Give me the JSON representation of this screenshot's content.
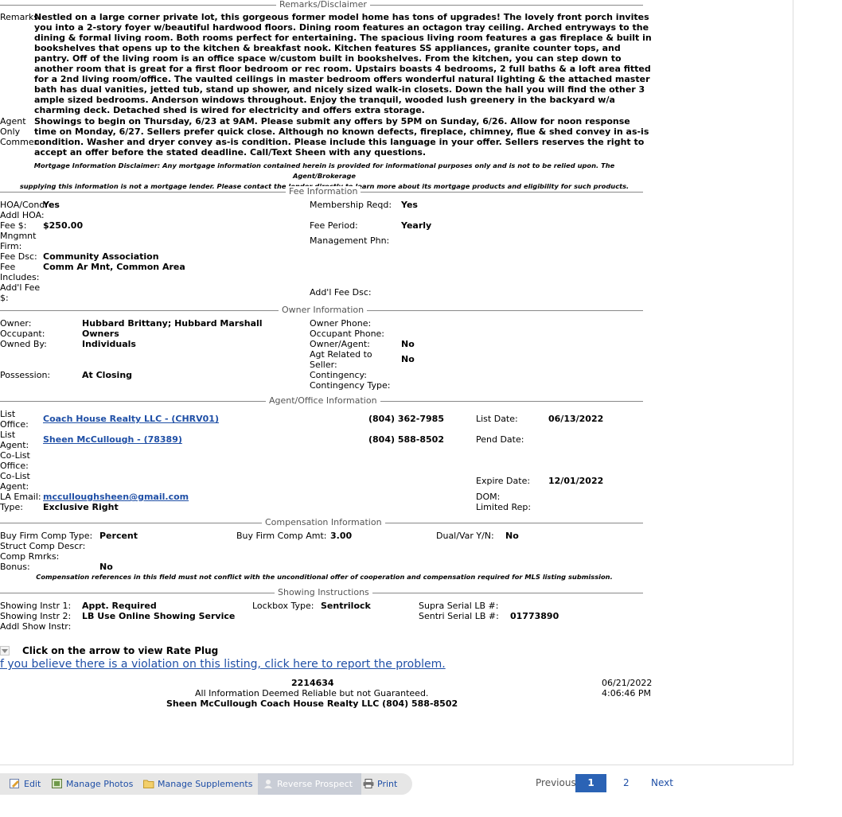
{
  "remarks_section": {
    "title": "Remarks/Disclaimer",
    "remarks_label": "Remarks",
    "remarks_lines": [
      "Nestled on a large corner private lot, this gorgeous former model home has tons of upgrades! The lovely front porch invites",
      "you into a 2-story foyer w/beautiful hardwood floors. Dining room features an octagon tray ceiling. Arched entryways to the",
      "dining & formal living room. Both rooms perfect for entertaining. The spacious living room features a gas fireplace & built in",
      "bookshelves that opens up to the kitchen & breakfast nook. Kitchen features SS appliances, granite counter tops, and",
      "pantry. Off of the living room is an office space w/custom built in bookshelves. From the kitchen, you can step down to",
      "another room that is great for a first floor bedroom or rec room. Upstairs boasts 4 bedrooms, 2 full baths & a loft area fitted",
      "for a 2nd living room/office. The vaulted ceilings in master bedroom offers wonderful natural lighting & the attached master",
      "bath has dual vanities, jetted tub, stand up shower, and nicely sized walk-in closets. Down the hall you will find the other 3",
      "ample sized bedrooms. Anderson windows throughout. Enjoy the tranquil, wooded lush greenery in the backyard w/a",
      "charming deck. Detached shed is wired for electricity and offers extra storage."
    ],
    "agent_label_1": "Agent",
    "agent_label_2": "Only",
    "agent_label_3": "Commen",
    "agent_lines": [
      "Showings to begin on Thursday, 6/23 at 9AM. Please submit any offers by 5PM on Sunday, 6/26. Allow for noon response",
      "time on Monday, 6/27. Sellers prefer quick close. Although no known defects, fireplace, chimney, flue & shed convey in as-is",
      "condition. Washer and dryer convey as-is condition. Please include this language in your offer. Sellers reserves the right to",
      "accept an offer before the stated deadline. Call/Text Sheen with any questions."
    ],
    "mortgage_disclaimer_1": "Mortgage Information Disclaimer: Any mortgage information contained herein is provided for informational purposes only and is not to be relied upon. The Agent/Brokerage",
    "mortgage_disclaimer_2": "supplying this information is not a mortgage lender. Please contact the lender directly to learn more about its mortgage products and eligibility for such products."
  },
  "fee_section": {
    "title": "Fee Information",
    "hoa_label": "HOA/Cond:",
    "hoa_value": "Yes",
    "addl_hoa_label": "Addl HOA:",
    "fee_label": "Fee $:",
    "fee_value": "$250.00",
    "mngmt_label_1": "Mngmnt",
    "mngmt_label_2": "Firm:",
    "fee_dsc_label": "Fee Dsc:",
    "fee_dsc_value": "Community Association",
    "fee_incl_label_1": "Fee",
    "fee_incl_label_2": "Includes:",
    "fee_incl_value": "Comm Ar Mnt, Common Area",
    "addl_fee_label_1": "Add'l Fee",
    "addl_fee_label_2": "$:",
    "membership_label": "Membership Reqd:",
    "membership_value": "Yes",
    "fee_period_label": "Fee Period:",
    "fee_period_value": "Yearly",
    "mgmt_phone_label": "Management Phn:",
    "addl_fee_dsc_label": "Add'l Fee Dsc:"
  },
  "owner_section": {
    "title": "Owner Information",
    "owner_label": "Owner:",
    "owner_value": "Hubbard Brittany; Hubbard Marshall",
    "occupant_label": "Occupant:",
    "occupant_value": "Owners",
    "owned_by_label": "Owned By:",
    "owned_by_value": "Individuals",
    "possession_label": "Possession:",
    "possession_value": "At Closing",
    "owner_phone_label": "Owner Phone:",
    "occupant_phone_label": "Occupant Phone:",
    "owner_agent_label": "Owner/Agent:",
    "owner_agent_value": "No",
    "agt_related_label_1": "Agt Related to",
    "agt_related_label_2": "Seller:",
    "agt_related_value": "No",
    "contingency_label": "Contingency:",
    "contingency_type_label": "Contingency Type:"
  },
  "agent_section": {
    "title": "Agent/Office Information",
    "list_office_label_1": "List",
    "list_office_label_2": "Office:",
    "list_office_value": "Coach House Realty LLC - (CHRV01)",
    "list_office_phone": "(804) 362-7985",
    "list_agent_label_1": "List",
    "list_agent_label_2": "Agent:",
    "list_agent_value": "Sheen McCullough - (78389)",
    "list_agent_phone": "(804) 588-8502",
    "colist_office_label_1": "Co-List",
    "colist_office_label_2": "Office:",
    "colist_agent_label_1": "Co-List",
    "colist_agent_label_2": "Agent:",
    "la_email_label": "LA Email:",
    "la_email_value": "mcculloughsheen@gmail.com",
    "type_label": "Type:",
    "type_value": "Exclusive Right",
    "list_date_label": "List Date:",
    "list_date_value": "06/13/2022",
    "pend_date_label": "Pend Date:",
    "expire_date_label": "Expire Date:",
    "expire_date_value": "12/01/2022",
    "dom_label": "DOM:",
    "limited_rep_label": "Limited Rep:"
  },
  "compensation_section": {
    "title": "Compensation Information",
    "buy_firm_type_label": "Buy Firm Comp Type:",
    "buy_firm_type_value": "Percent",
    "buy_firm_amt_label": "Buy Firm Comp Amt:",
    "buy_firm_amt_value": "3.00",
    "dual_var_label": "Dual/Var Y/N:",
    "dual_var_value": "No",
    "struct_label": "Struct Comp Descr:",
    "comp_rmrks_label": "Comp Rmrks:",
    "bonus_label": "Bonus:",
    "bonus_value": "No",
    "comp_disclaimer": "Compensation references in this field must not conflict with the unconditional offer of cooperation and compensation required for MLS listing submission."
  },
  "showing_section": {
    "title": "Showing Instructions",
    "instr1_label": "Showing Instr 1:",
    "instr1_value": "Appt. Required",
    "instr2_label": "Showing Instr 2:",
    "instr2_value": "LB Use Online Showing Service",
    "addl_label": "Addl Show Instr:",
    "lockbox_label": "Lockbox Type:",
    "lockbox_value": "Sentrilock",
    "supra_label": "Supra Serial LB #:",
    "sentri_label": "Sentri Serial LB #:",
    "sentri_value": "01773890"
  },
  "footer": {
    "rate_plug_label": "Click on the arrow to view Rate Plug",
    "violation_link": "f you believe there is a violation on this listing, click here to report the problem.",
    "listing_number": "2214634",
    "reliability": "All Information Deemed Reliable but not Guaranteed.",
    "agent_line": "Sheen McCullough Coach House Realty LLC (804) 588-8502",
    "date": "06/21/2022",
    "time": "4:06:46 PM"
  },
  "toolbar": {
    "edit": "Edit",
    "manage_photos": "Manage Photos",
    "manage_supplements": "Manage Supplements",
    "reverse_prospect": "Reverse Prospect",
    "print": "Print"
  },
  "pager": {
    "previous": "Previous",
    "page1": "1",
    "page2": "2",
    "next": "Next"
  },
  "colors": {
    "link": "#1f4fa6",
    "pager_active": "#2b63b5",
    "toolbar_bg": "#e6e6e6"
  }
}
